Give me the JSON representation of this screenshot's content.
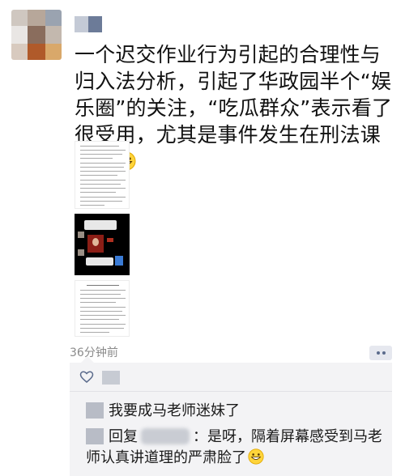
{
  "post": {
    "text": "一个迟交作业行为引起的合理性与归入法分析，引起了华政园半个“娱乐圈”的关注，“吃瓜群众”表示看了很受用，尤其是事件发生在刑法课堂上",
    "emoji": "grinning-face-emoji",
    "timestamp": "36分钟前",
    "images": [
      "document-screenshot",
      "chat-screenshot",
      "document-screenshot"
    ]
  },
  "comments": [
    {
      "text": "我要成马老师迷妹了"
    },
    {
      "reply_label": "回复",
      "text": "：是呀，隔着屏幕感受到马老师认真讲道理的严肃脸了"
    }
  ],
  "icons": {
    "more": "more-dots-icon",
    "like": "heart-outline-icon"
  },
  "colors": {
    "link": "#5b6b8c",
    "comment_bg": "#f3f3f5"
  }
}
